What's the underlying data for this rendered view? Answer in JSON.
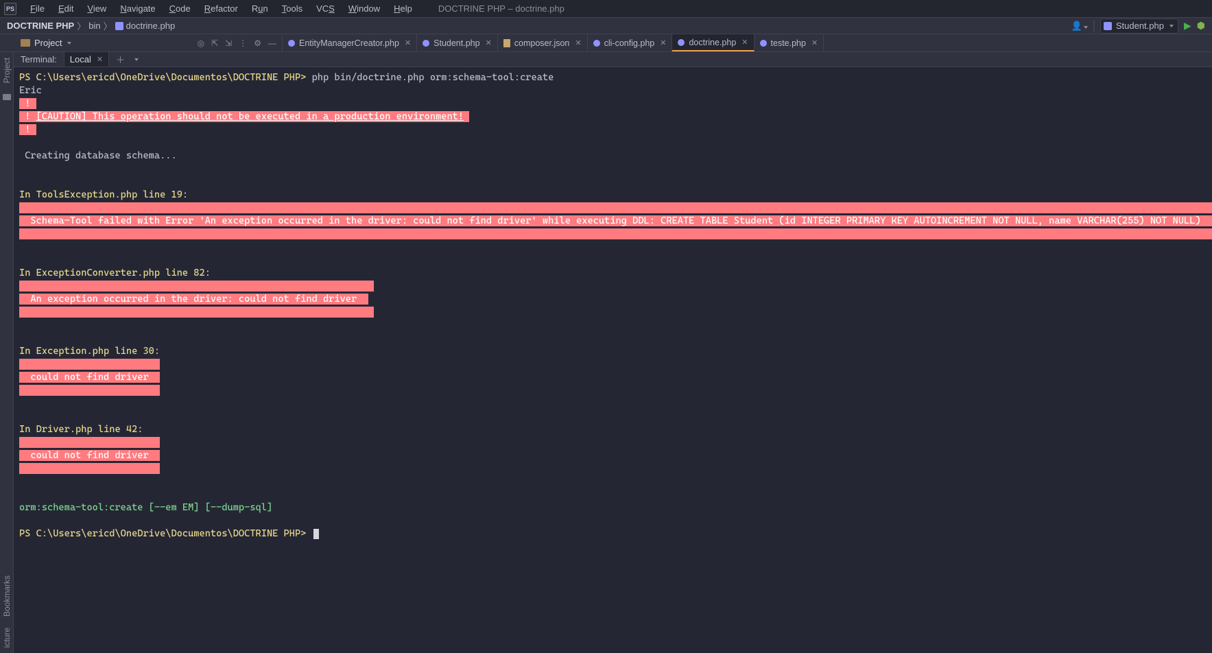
{
  "menubar": {
    "logo": "PS",
    "items": [
      "File",
      "Edit",
      "View",
      "Navigate",
      "Code",
      "Refactor",
      "Run",
      "Tools",
      "VCS",
      "Window",
      "Help"
    ],
    "title": "DOCTRINE PHP – doctrine.php"
  },
  "navbar": {
    "crumbs": [
      "DOCTRINE PHP",
      "bin",
      "doctrine.php"
    ],
    "run_config": "Student.php"
  },
  "project_panel": {
    "label": "Project"
  },
  "editor_tabs": [
    {
      "name": "EntityManagerCreator.php",
      "type": "php",
      "active": false
    },
    {
      "name": "Student.php",
      "type": "php",
      "active": false
    },
    {
      "name": "composer.json",
      "type": "json",
      "active": false
    },
    {
      "name": "cli-config.php",
      "type": "php",
      "active": false
    },
    {
      "name": "doctrine.php",
      "type": "php",
      "active": true
    },
    {
      "name": "teste.php",
      "type": "php",
      "active": false
    }
  ],
  "sidebar": {
    "top": "Project",
    "bottom1": "Bookmarks",
    "bottom2": "icture"
  },
  "terminal": {
    "tab_label": "Terminal:",
    "tab_name": "Local",
    "prompt1_path": "PS C:\\Users\\ericd\\OneDrive\\Documentos\\DOCTRINE PHP> ",
    "prompt1_cmd": "php bin/doctrine.php orm:schema-tool:create",
    "line_user": "Eric",
    "caution": [
      " ! ",
      " ! [CAUTION] This operation should not be executed in a production environment! ",
      " ! "
    ],
    "creating": " Creating database schema...",
    "blocks": [
      {
        "header": "In ToolsException.php line 19:",
        "msg": "  Schema-Tool failed with Error 'An exception occurred in the driver: could not find driver' while executing DDL: CREATE TABLE Student (id INTEGER PRIMARY KEY AUTOINCREMENT NOT NULL, name VARCHAR(255) NOT NULL)  ",
        "pad": "                                                                                                                                                                                                                     "
      },
      {
        "header": "In ExceptionConverter.php line 82:",
        "msg": "  An exception occurred in the driver: could not find driver  ",
        "pad": "                                                               "
      },
      {
        "header": "In Exception.php line 30:",
        "msg": "  could not find driver  ",
        "pad": "                         "
      },
      {
        "header": "In Driver.php line 42:",
        "msg": "  could not find driver  ",
        "pad": "                         "
      }
    ],
    "usage": "orm:schema-tool:create [--em EM] [--dump-sql]",
    "prompt2": "PS C:\\Users\\ericd\\OneDrive\\Documentos\\DOCTRINE PHP> "
  }
}
